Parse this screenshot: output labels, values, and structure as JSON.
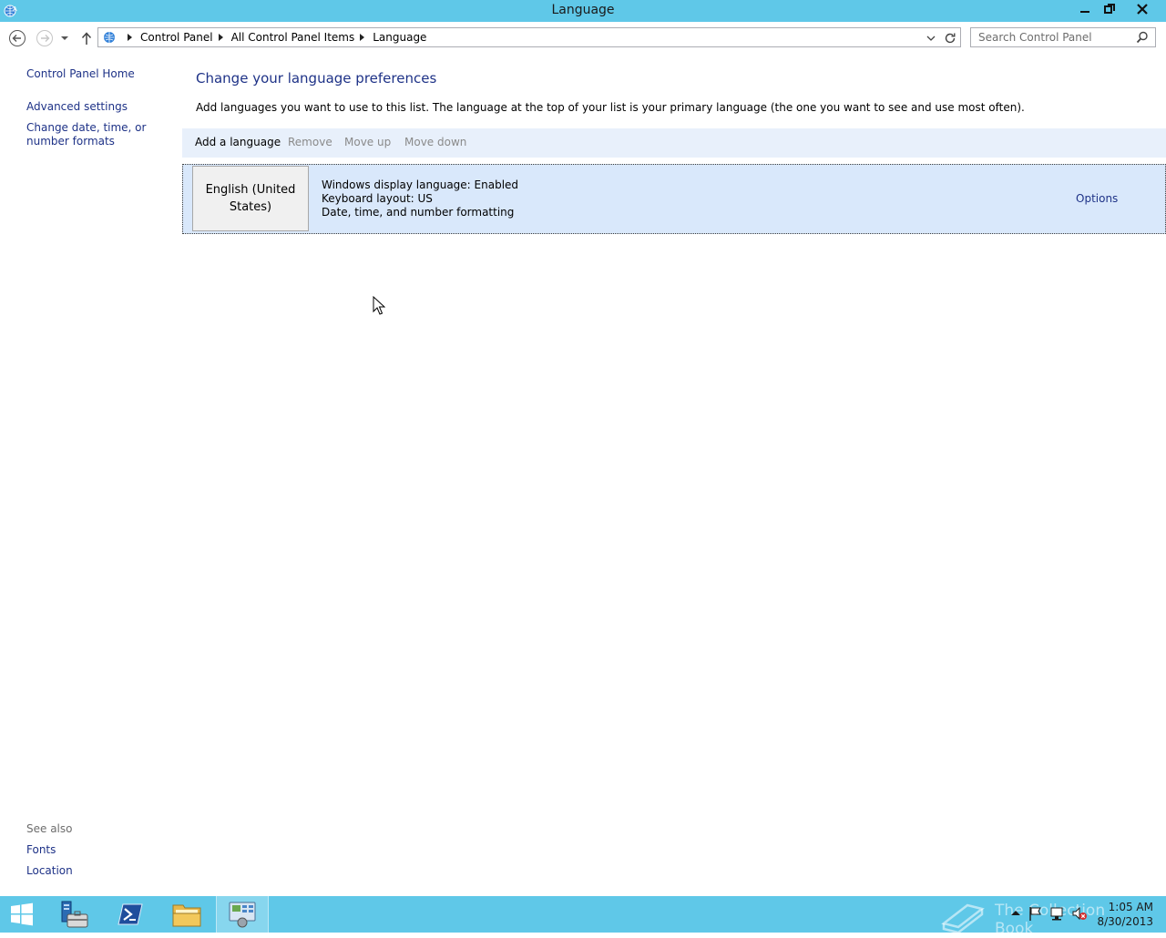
{
  "window": {
    "title": "Language"
  },
  "address": {
    "crumbs": [
      "Control Panel",
      "All Control Panel Items",
      "Language"
    ]
  },
  "search": {
    "placeholder": "Search Control Panel"
  },
  "left_pane": {
    "home": "Control Panel Home",
    "links": [
      "Advanced settings",
      "Change date, time, or number formats"
    ],
    "see_also_label": "See also",
    "see_also": [
      "Fonts",
      "Location"
    ]
  },
  "main": {
    "heading": "Change your language preferences",
    "description": "Add languages you want to use to this list. The language at the top of your list is your primary language (the one you want to see and use most often).",
    "toolbar": {
      "add": "Add a language",
      "remove": "Remove",
      "move_up": "Move up",
      "move_down": "Move down"
    },
    "languages": [
      {
        "name": "English (United States)",
        "details": [
          "Windows display language: Enabled",
          "Keyboard layout: US",
          "Date, time, and number formatting"
        ],
        "options_label": "Options"
      }
    ]
  },
  "taskbar": {
    "apps": [
      "start-icon",
      "server-manager-icon",
      "powershell-icon",
      "file-explorer-icon",
      "control-panel-icon"
    ],
    "watermark": "The Collection Book",
    "clock": {
      "time": "1:05 AM",
      "date": "8/30/2013"
    }
  },
  "colors": {
    "accent": "#5fc8e8",
    "link": "#1e3287",
    "selection": "#d9e8fb",
    "toolbar": "#e8f0fb"
  }
}
